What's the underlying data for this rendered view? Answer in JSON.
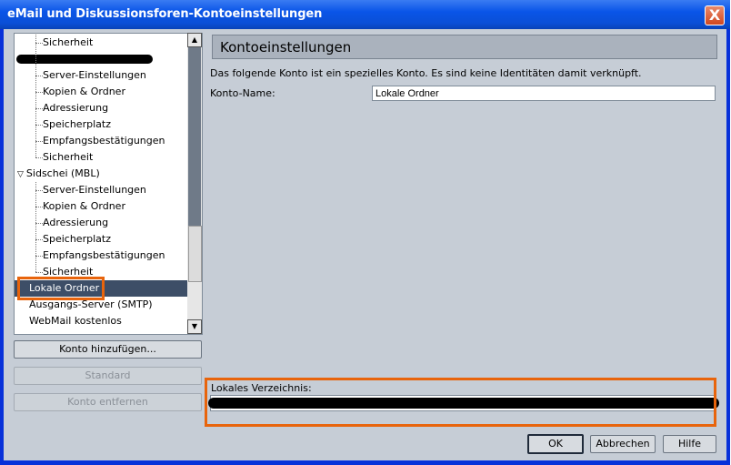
{
  "window": {
    "title": "eMail und Diskussionsforen-Kontoeinstellungen",
    "close_label": "X"
  },
  "tree": {
    "items": [
      {
        "label": "Sicherheit",
        "level": 1
      },
      {
        "label": "",
        "level": 0,
        "redacted": true
      },
      {
        "label": "Server-Einstellungen",
        "level": 1
      },
      {
        "label": "Kopien & Ordner",
        "level": 1
      },
      {
        "label": "Adressierung",
        "level": 1
      },
      {
        "label": "Speicherplatz",
        "level": 1
      },
      {
        "label": "Empfangsbestätigungen",
        "level": 1
      },
      {
        "label": "Sicherheit",
        "level": 1
      },
      {
        "label": "Sidschei (MBL)",
        "level": 0,
        "expanded": true
      },
      {
        "label": "Server-Einstellungen",
        "level": 1
      },
      {
        "label": "Kopien & Ordner",
        "level": 1
      },
      {
        "label": "Adressierung",
        "level": 1
      },
      {
        "label": "Speicherplatz",
        "level": 1
      },
      {
        "label": "Empfangsbestätigungen",
        "level": 1
      },
      {
        "label": "Sicherheit",
        "level": 1
      },
      {
        "label": "Lokale Ordner",
        "level": 0,
        "selected": true
      },
      {
        "label": "Ausgangs-Server (SMTP)",
        "level": 0
      },
      {
        "label": "WebMail kostenlos",
        "level": 0
      }
    ]
  },
  "buttons": {
    "add_account": "Konto hinzufügen...",
    "default": "Standard",
    "remove_account": "Konto entfernen",
    "ok": "OK",
    "cancel": "Abbrechen",
    "help": "Hilfe"
  },
  "panel": {
    "title": "Kontoeinstellungen",
    "description": "Das folgende Konto ist ein spezielles Konto. Es sind keine Identitäten damit verknüpft.",
    "account_name_label": "Konto-Name:",
    "account_name_value": "Lokale Ordner",
    "local_dir_label": "Lokales Verzeichnis:"
  },
  "colors": {
    "highlight": "#e8640c",
    "selection": "#3d4e67"
  }
}
